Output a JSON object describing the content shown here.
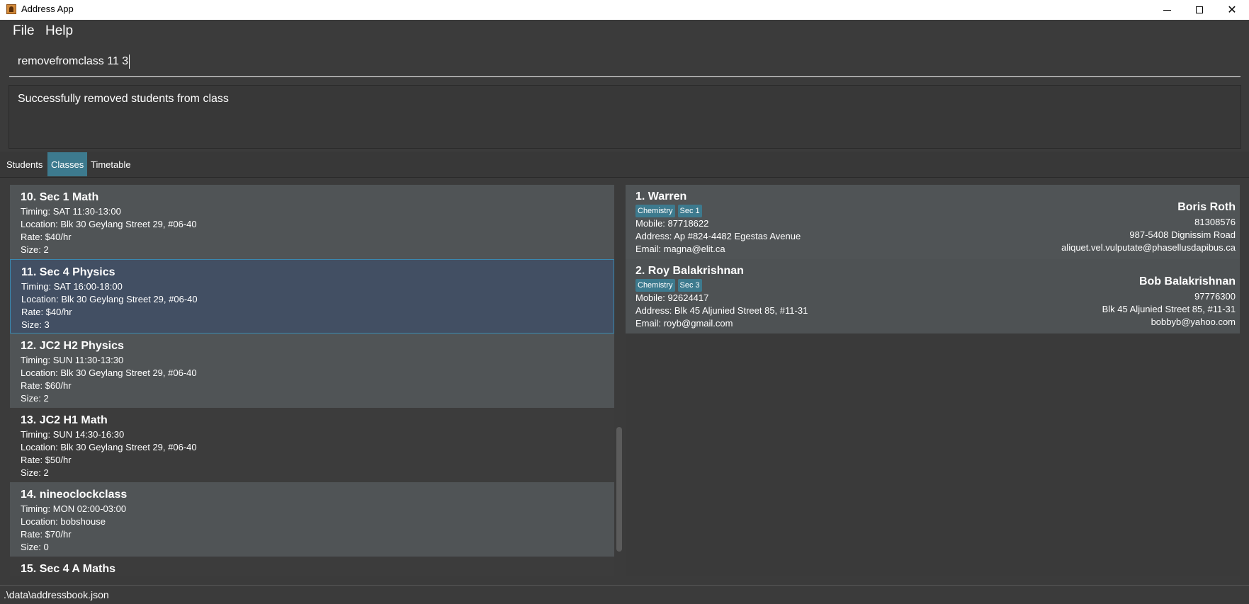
{
  "window": {
    "title": "Address App"
  },
  "menu": {
    "file": "File",
    "help": "Help"
  },
  "command": {
    "value": "removefromclass 11 3"
  },
  "result": {
    "message": "Successfully removed students from class"
  },
  "tabs": {
    "students": "Students",
    "classes": "Classes",
    "timetable": "Timetable",
    "active": "Classes"
  },
  "classes": [
    {
      "title": "10.  Sec 1 Math",
      "timing": "Timing: SAT 11:30-13:00",
      "location": "Location: Blk 30 Geylang Street 29, #06-40",
      "rate": "Rate: $40/hr",
      "size": "Size: 2"
    },
    {
      "title": "11.  Sec 4 Physics",
      "timing": "Timing: SAT 16:00-18:00",
      "location": "Location: Blk 30 Geylang Street 29, #06-40",
      "rate": "Rate: $40/hr",
      "size": "Size: 3",
      "selected": true
    },
    {
      "title": "12.  JC2 H2 Physics",
      "timing": "Timing: SUN 11:30-13:30",
      "location": "Location: Blk 30 Geylang Street 29, #06-40",
      "rate": "Rate: $60/hr",
      "size": "Size: 2"
    },
    {
      "title": "13.  JC2 H1 Math",
      "timing": "Timing: SUN 14:30-16:30",
      "location": "Location: Blk 30 Geylang Street 29, #06-40",
      "rate": "Rate: $50/hr",
      "size": "Size: 2"
    },
    {
      "title": "14.  nineoclockclass",
      "timing": "Timing: MON 02:00-03:00",
      "location": "Location: bobshouse",
      "rate": "Rate: $70/hr",
      "size": "Size: 0"
    },
    {
      "title": "15.  Sec 4 A Maths"
    }
  ],
  "students": [
    {
      "name": "1.  Warren",
      "tags": [
        "Chemistry",
        "Sec 1"
      ],
      "mobile": "Mobile: 87718622",
      "address": "Address: Ap #824-4482 Egestas Avenue",
      "email": "Email: magna@elit.ca",
      "parent_name": "Boris Roth",
      "parent_phone": "81308576",
      "parent_address": "987-5408 Dignissim Road",
      "parent_email": "aliquet.vel.vulputate@phasellusdapibus.ca"
    },
    {
      "name": "2.  Roy Balakrishnan",
      "tags": [
        "Chemistry",
        "Sec 3"
      ],
      "mobile": "Mobile: 92624417",
      "address": "Address: Blk 45 Aljunied Street 85, #11-31",
      "email": "Email: royb@gmail.com",
      "parent_name": "Bob Balakrishnan",
      "parent_phone": "97776300",
      "parent_address": "Blk 45 Aljunied Street 85, #11-31",
      "parent_email": "bobbyb@yahoo.com"
    }
  ],
  "status": {
    "path": ".\\data\\addressbook.json"
  }
}
